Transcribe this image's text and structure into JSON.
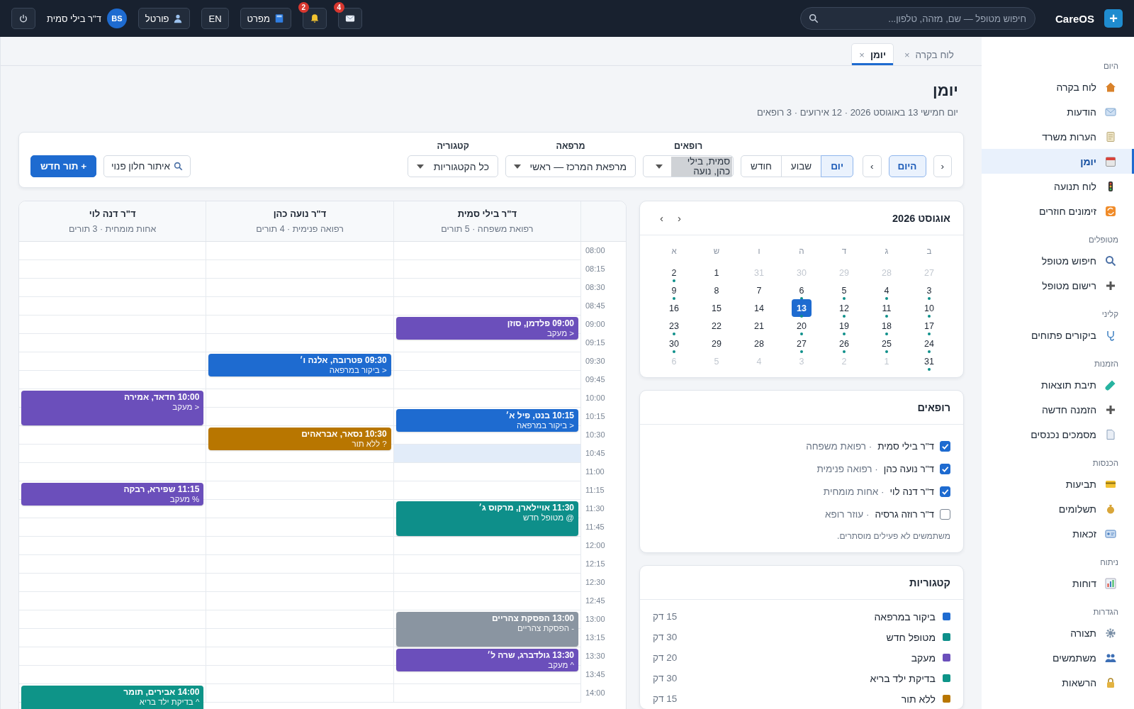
{
  "topbar": {
    "logo": "+",
    "brand": "CareOS",
    "search": {
      "placeholder": "חיפוש מטופל — שם, מזהה, טלפון..."
    },
    "buttons": [
      {
        "kind": "mail",
        "badge": "4"
      },
      {
        "kind": "bell",
        "badge": "2"
      },
      {
        "kind": "book",
        "label": "מפרט"
      },
      {
        "kind": "text",
        "label": "EN"
      },
      {
        "kind": "person",
        "label": "פורטל"
      }
    ],
    "user": {
      "initials": "BS",
      "name": "ד\"ר בילי סמית"
    }
  },
  "sidebar": [
    {
      "title": "היום",
      "items": [
        {
          "label": "לוח בקרה",
          "selected": false
        },
        {
          "label": "הודעות",
          "selected": false
        },
        {
          "label": "הערות משרד",
          "selected": false
        },
        {
          "label": "יומן",
          "selected": true
        },
        {
          "label": "לוח תנועה",
          "selected": false
        },
        {
          "label": "זימונים חוזרים",
          "selected": false
        }
      ]
    },
    {
      "title": "מטופלים",
      "items": [
        {
          "label": "חיפוש מטופל",
          "selected": false
        },
        {
          "label": "רישום מטופל",
          "selected": false
        }
      ]
    },
    {
      "title": "קליני",
      "items": [
        {
          "label": "ביקורים פתוחים",
          "selected": false
        }
      ]
    },
    {
      "title": "הזמנות",
      "items": [
        {
          "label": "תיבת תוצאות",
          "selected": false
        },
        {
          "label": "הזמנה חדשה",
          "selected": false
        },
        {
          "label": "מסמכים נכנסים",
          "selected": false
        }
      ]
    },
    {
      "title": "הכנסות",
      "items": [
        {
          "label": "תביעות",
          "selected": false
        },
        {
          "label": "תשלומים",
          "selected": false
        },
        {
          "label": "זכאות",
          "selected": false
        }
      ]
    },
    {
      "title": "ניתוח",
      "items": [
        {
          "label": "דוחות",
          "selected": false
        }
      ]
    },
    {
      "title": "הגדרות",
      "items": [
        {
          "label": "תצורה",
          "selected": false
        },
        {
          "label": "משתמשים",
          "selected": false
        },
        {
          "label": "הרשאות",
          "selected": false
        }
      ]
    }
  ],
  "tabs": [
    {
      "label": "לוח בקרה",
      "close": "×",
      "selected": false
    },
    {
      "label": "יומן",
      "close": "×",
      "selected": true
    }
  ],
  "header": {
    "title": "יומן",
    "subtitle": "יום חמישי 13 באוגוסט 2026 · 12 אירועים · 3 רופאים"
  },
  "filters": {
    "prev": "‹",
    "today": "היום",
    "next": "›",
    "views": [
      {
        "label": "יום",
        "selected": true
      },
      {
        "label": "שבוע",
        "selected": false
      },
      {
        "label": "חודש",
        "selected": false
      }
    ],
    "selects": [
      {
        "label": "רופאים",
        "value": "סמית, בילי כהן, נועה",
        "highlighted": true
      },
      {
        "label": "מרפאה",
        "value": "מרפאת המרכז — ראשי",
        "highlighted": false
      },
      {
        "label": "קטגוריה",
        "value": "כל הקטגוריות",
        "highlighted": false
      }
    ],
    "find_slot": "איתור חלון פנוי",
    "new_plus": "+",
    "new_label": "תור חדש"
  },
  "calendar": {
    "title": "אוגוסט 2026",
    "prev": "‹",
    "next": "›",
    "weekdays": [
      "ב",
      "ג",
      "ד",
      "ה",
      "ו",
      "ש",
      "א"
    ],
    "days": [
      {
        "day": "27",
        "outside": true,
        "events": false,
        "selected": false
      },
      {
        "day": "28",
        "outside": true,
        "events": false,
        "selected": false
      },
      {
        "day": "29",
        "outside": true,
        "events": false,
        "selected": false
      },
      {
        "day": "30",
        "outside": true,
        "events": false,
        "selected": false
      },
      {
        "day": "31",
        "outside": true,
        "events": false,
        "selected": false
      },
      {
        "day": "1",
        "outside": false,
        "events": false,
        "selected": false
      },
      {
        "day": "2",
        "outside": false,
        "events": true,
        "selected": false
      },
      {
        "day": "3",
        "outside": false,
        "events": true,
        "selected": false
      },
      {
        "day": "4",
        "outside": false,
        "events": true,
        "selected": false
      },
      {
        "day": "5",
        "outside": false,
        "events": true,
        "selected": false
      },
      {
        "day": "6",
        "outside": false,
        "events": true,
        "selected": false
      },
      {
        "day": "7",
        "outside": false,
        "events": false,
        "selected": false
      },
      {
        "day": "8",
        "outside": false,
        "events": false,
        "selected": false
      },
      {
        "day": "9",
        "outside": false,
        "events": true,
        "selected": false
      },
      {
        "day": "10",
        "outside": false,
        "events": true,
        "selected": false
      },
      {
        "day": "11",
        "outside": false,
        "events": true,
        "selected": false
      },
      {
        "day": "12",
        "outside": false,
        "events": true,
        "selected": false
      },
      {
        "day": "13",
        "outside": false,
        "events": true,
        "selected": true
      },
      {
        "day": "14",
        "outside": false,
        "events": false,
        "selected": false
      },
      {
        "day": "15",
        "outside": false,
        "events": false,
        "selected": false
      },
      {
        "day": "16",
        "outside": false,
        "events": false,
        "selected": false
      },
      {
        "day": "17",
        "outside": false,
        "events": true,
        "selected": false
      },
      {
        "day": "18",
        "outside": false,
        "events": true,
        "selected": false
      },
      {
        "day": "19",
        "outside": false,
        "events": true,
        "selected": false
      },
      {
        "day": "20",
        "outside": false,
        "events": true,
        "selected": false
      },
      {
        "day": "21",
        "outside": false,
        "events": false,
        "selected": false
      },
      {
        "day": "22",
        "outside": false,
        "events": false,
        "selected": false
      },
      {
        "day": "23",
        "outside": false,
        "events": true,
        "selected": false
      },
      {
        "day": "24",
        "outside": false,
        "events": true,
        "selected": false
      },
      {
        "day": "25",
        "outside": false,
        "events": true,
        "selected": false
      },
      {
        "day": "26",
        "outside": false,
        "events": true,
        "selected": false
      },
      {
        "day": "27",
        "outside": false,
        "events": true,
        "selected": false
      },
      {
        "day": "28",
        "outside": false,
        "events": false,
        "selected": false
      },
      {
        "day": "29",
        "outside": false,
        "events": false,
        "selected": false
      },
      {
        "day": "30",
        "outside": false,
        "events": true,
        "selected": false
      },
      {
        "day": "31",
        "outside": false,
        "events": true,
        "selected": false
      },
      {
        "day": "1",
        "outside": true,
        "events": false,
        "selected": false
      },
      {
        "day": "2",
        "outside": true,
        "events": false,
        "selected": false
      },
      {
        "day": "3",
        "outside": true,
        "events": false,
        "selected": false
      },
      {
        "day": "4",
        "outside": true,
        "events": false,
        "selected": false
      },
      {
        "day": "5",
        "outside": true,
        "events": false,
        "selected": false
      },
      {
        "day": "6",
        "outside": true,
        "events": false,
        "selected": false
      }
    ]
  },
  "doctors_panel": {
    "title": "רופאים",
    "items": [
      {
        "name": "ד\"ר בילי סמית",
        "specialty": "· רפואת משפחה",
        "checked": true
      },
      {
        "name": "ד\"ר נועה כהן",
        "specialty": "· רפואה פנימית",
        "checked": true
      },
      {
        "name": "ד\"ר דנה לוי",
        "specialty": "· אחות מומחית",
        "checked": true
      },
      {
        "name": "ד\"ר רוזה גרסיה",
        "specialty": "· עוזר רופא",
        "checked": false
      }
    ],
    "note": "משתמשים לא פעילים מוסתרים."
  },
  "categories_panel": {
    "title": "קטגוריות",
    "items": [
      {
        "name": "ביקור במרפאה",
        "duration": "15 דק",
        "color": "#1e6bd0"
      },
      {
        "name": "מטופל חדש",
        "duration": "30 דק",
        "color": "#0e8f8a"
      },
      {
        "name": "מעקב",
        "duration": "20 דק",
        "color": "#6b4fbb"
      },
      {
        "name": "בדיקת ילד בריא",
        "duration": "30 דק",
        "color": "#0e9488"
      },
      {
        "name": "ללא תור",
        "duration": "15 דק",
        "color": "#b87600"
      }
    ]
  },
  "schedule": {
    "times": [
      {
        "label": "08:00",
        "highlighted": false
      },
      {
        "label": "08:15",
        "highlighted": false
      },
      {
        "label": "08:30",
        "highlighted": false
      },
      {
        "label": "08:45",
        "highlighted": false
      },
      {
        "label": "09:00",
        "highlighted": false
      },
      {
        "label": "09:15",
        "highlighted": false
      },
      {
        "label": "09:30",
        "highlighted": false
      },
      {
        "label": "09:45",
        "highlighted": false
      },
      {
        "label": "10:00",
        "highlighted": false
      },
      {
        "label": "10:15",
        "highlighted": false
      },
      {
        "label": "10:30",
        "highlighted": false
      },
      {
        "label": "10:45",
        "highlighted": true
      },
      {
        "label": "11:00",
        "highlighted": false
      },
      {
        "label": "11:15",
        "highlighted": false
      },
      {
        "label": "11:30",
        "highlighted": false
      },
      {
        "label": "11:45",
        "highlighted": false
      },
      {
        "label": "12:00",
        "highlighted": false
      },
      {
        "label": "12:15",
        "highlighted": false
      },
      {
        "label": "12:30",
        "highlighted": false
      },
      {
        "label": "12:45",
        "highlighted": false
      },
      {
        "label": "13:00",
        "highlighted": false
      },
      {
        "label": "13:15",
        "highlighted": false
      },
      {
        "label": "13:30",
        "highlighted": false
      },
      {
        "label": "13:45",
        "highlighted": false
      },
      {
        "label": "14:00",
        "highlighted": false
      }
    ],
    "columns": [
      {
        "name": "ד\"ר בילי סמית",
        "meta": "רפואת משפחה · 5 תורים",
        "events": [
          {
            "time": "09:00",
            "patient": "פלדמן, סוזן",
            "detail": "< מעקב",
            "long": false,
            "color": "#6b4fbb"
          },
          {
            "time": "10:15",
            "patient": "בנט, פיל א׳",
            "detail": "< ביקור במרפאה",
            "long": false,
            "color": "#1e6bd0"
          },
          {
            "time": "11:30",
            "patient": "אויילארן, מרקוס ג׳",
            "detail": "@ מטופל חדש",
            "long": true,
            "color": "#0e8f8a"
          },
          {
            "time": "13:00",
            "patient": "הפסקת צהריים",
            "detail": "- הפסקת צהריים",
            "long": true,
            "color": "#8a95a1"
          },
          {
            "time": "13:30",
            "patient": "גולדברג, שרה ל׳",
            "detail": "^ מעקב",
            "long": false,
            "color": "#6b4fbb"
          }
        ]
      },
      {
        "name": "ד\"ר נועה כהן",
        "meta": "רפואה פנימית · 4 תורים",
        "events": [
          {
            "time": "09:30",
            "patient": "פטרובה, אלנה ו׳",
            "detail": "< ביקור במרפאה",
            "long": false,
            "color": "#1e6bd0"
          },
          {
            "time": "10:30",
            "patient": "נסאר, אבראהים",
            "detail": "? ללא תור",
            "long": false,
            "color": "#b87600"
          }
        ]
      },
      {
        "name": "ד\"ר דנה לוי",
        "meta": "אחות מומחית · 3 תורים",
        "events": [
          {
            "time": "10:00",
            "patient": "חדאד, אמירה",
            "detail": "< מעקב",
            "long": true,
            "color": "#6b4fbb"
          },
          {
            "time": "11:15",
            "patient": "שפירא, רבקה",
            "detail": "% מעקב",
            "long": false,
            "color": "#6b4fbb"
          },
          {
            "time": "14:00",
            "patient": "אבירים, תומר",
            "detail": "^ בדיקת ילד בריא",
            "long": true,
            "color": "#0e9488"
          }
        ]
      }
    ]
  }
}
